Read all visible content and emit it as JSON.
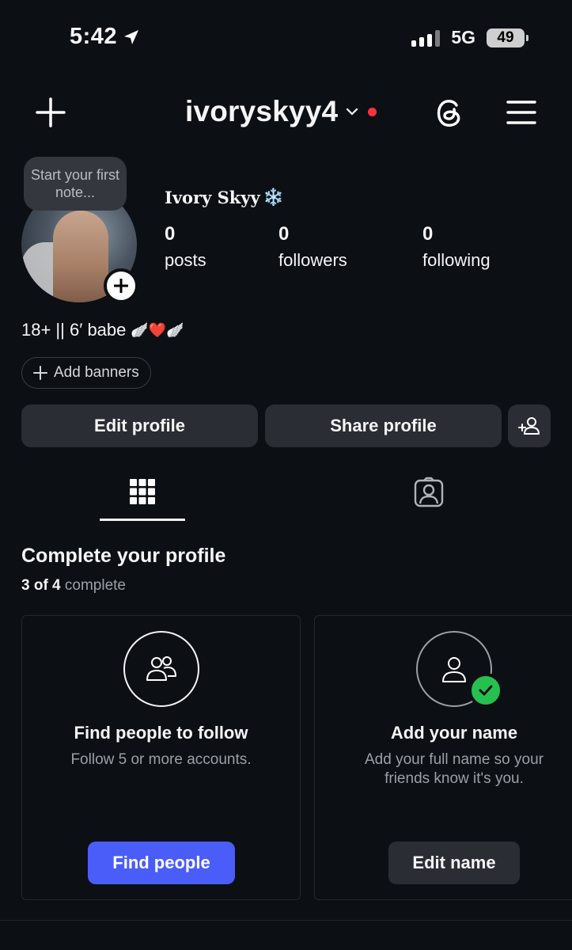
{
  "status_bar": {
    "time": "5:42",
    "network": "5G",
    "battery": "49"
  },
  "header": {
    "username": "ivoryskyy4"
  },
  "profile": {
    "note_placeholder": "Start your first note...",
    "display_name": "Ivory Skyy",
    "name_emoji": "❄️",
    "stats": [
      {
        "value": "0",
        "label": "posts"
      },
      {
        "value": "0",
        "label": "followers"
      },
      {
        "value": "0",
        "label": "following"
      }
    ],
    "bio": "18+ || 6′ babe",
    "bio_emoji": "🪽❤️🪽",
    "add_banners_label": "Add banners"
  },
  "actions": {
    "edit_profile": "Edit profile",
    "share_profile": "Share profile"
  },
  "tabs": [
    {
      "name": "grid",
      "active": true
    },
    {
      "name": "tagged",
      "active": false
    }
  ],
  "complete_profile": {
    "title": "Complete your profile",
    "progress_done": "3 of 4",
    "progress_suffix": " complete",
    "cards": [
      {
        "title": "Find people to follow",
        "description": "Follow 5 or more accounts.",
        "button": "Find people",
        "icon": "people-icon",
        "done": false
      },
      {
        "title": "Add your name",
        "description": "Add your full name so your friends know it's you.",
        "button": "Edit name",
        "icon": "person-icon",
        "done": true
      }
    ]
  },
  "colors": {
    "background": "#0c0f14",
    "accent_blue": "#4a5df9",
    "notification_red": "#ff3040",
    "success_green": "#26c04f"
  }
}
